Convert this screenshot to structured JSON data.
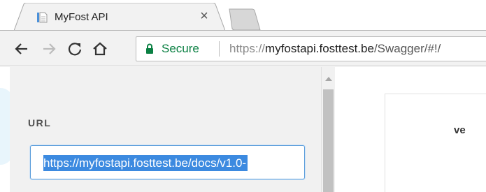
{
  "browser": {
    "tab": {
      "title": "MyFost API",
      "close_glyph": "×",
      "favicon_icon": "document-icon"
    },
    "toolbar": {
      "back_icon": "back-arrow-icon",
      "forward_icon": "forward-arrow-icon",
      "reload_icon": "reload-icon",
      "home_icon": "home-icon"
    },
    "omnibox": {
      "secure_label": "Secure",
      "url_scheme": "https://",
      "url_host": "myfostapi.fosttest.be",
      "url_path": "/Swagger/#!/",
      "secure_color": "#0b8043"
    }
  },
  "page": {
    "sidebar": {
      "url_label": "URL",
      "url_value": "https://myfostapi.fosttest.be/docs/v1.0-",
      "selection_color": "#3c8ae0"
    },
    "card": {
      "text_partial": "ve"
    }
  }
}
